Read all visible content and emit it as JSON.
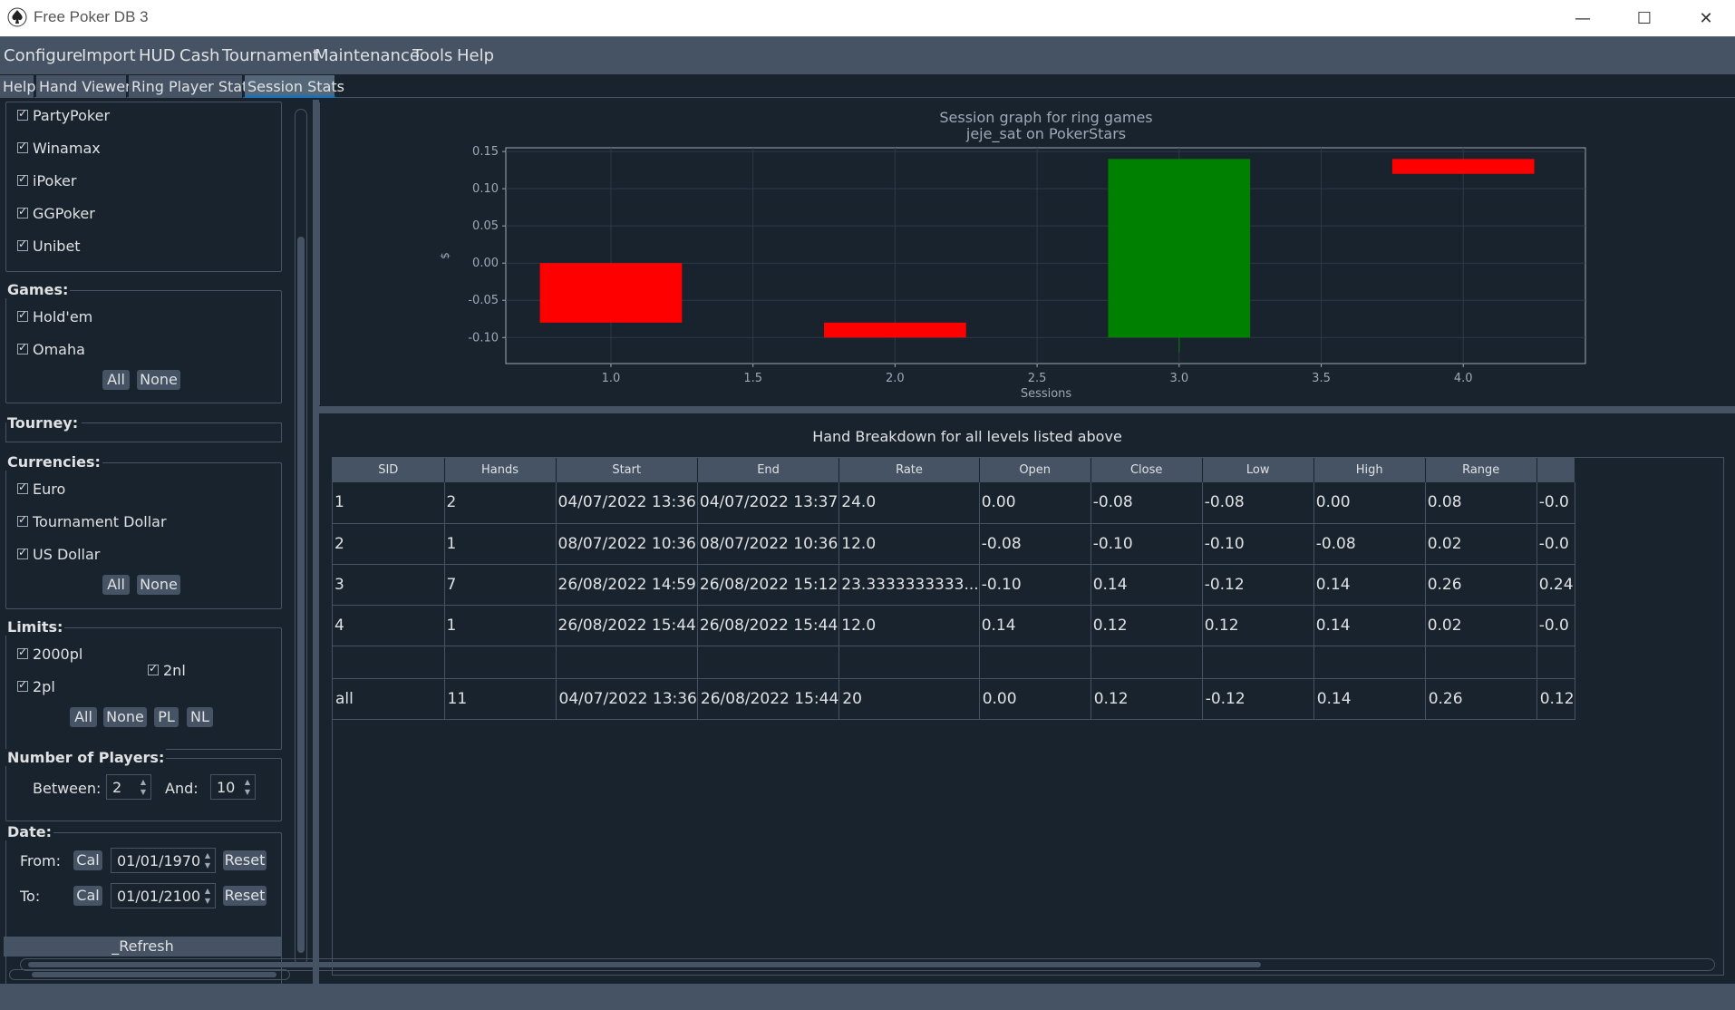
{
  "window": {
    "title": "Free Poker DB 3",
    "minimize": "—",
    "maximize": "☐",
    "close": "✕"
  },
  "menu": [
    "Configure",
    "Import",
    "HUD",
    "Cash",
    "Tournament",
    "Maintenance",
    "Tools",
    "Help"
  ],
  "tabs": [
    "Help",
    "Hand Viewer",
    "Ring Player Stats",
    "Session Stats"
  ],
  "active_tab": "Session Stats",
  "filters": {
    "sites": [
      "PartyPoker",
      "Winamax",
      "iPoker",
      "GGPoker",
      "Unibet"
    ],
    "games_label": "Games:",
    "games": [
      "Hold'em",
      "Omaha"
    ],
    "tourney_label": "Tourney:",
    "currencies_label": "Currencies:",
    "currencies": [
      "Euro",
      "Tournament Dollar",
      "US Dollar"
    ],
    "limits_label": "Limits:",
    "limits": [
      "2000pl",
      "2nl",
      "2pl"
    ],
    "all_label": "All",
    "none_label": "None",
    "pl_label": "PL",
    "nl_label": "NL",
    "players_label": "Number of Players:",
    "between_label": "Between:",
    "and_label": "And:",
    "players_min": "2",
    "players_max": "10",
    "date_label": "Date:",
    "from_label": "From:",
    "to_label": "To:",
    "cal_label": "Cal",
    "reset_label": "Reset",
    "from_date": "01/01/1970",
    "to_date": "01/01/2100",
    "refresh_label": "_Refresh"
  },
  "chart_data": {
    "type": "candlestick",
    "title": "Session graph for ring games",
    "subtitle": "jeje_sat on PokerStars",
    "xlabel": "Sessions",
    "ylabel": "$",
    "xlim": [
      0.63,
      4.43
    ],
    "ylim": [
      -0.135,
      0.155
    ],
    "xticks": [
      "1.0",
      "1.5",
      "2.0",
      "2.5",
      "3.0",
      "3.5",
      "4.0"
    ],
    "yticks": [
      "0.15",
      "0.10",
      "0.05",
      "0.00",
      "-0.05",
      "-0.10"
    ],
    "candles": [
      {
        "x": 1,
        "open": 0.0,
        "close": -0.08,
        "low": -0.08,
        "high": 0.0,
        "color": "#ff0000"
      },
      {
        "x": 2,
        "open": -0.08,
        "close": -0.1,
        "low": -0.1,
        "high": -0.08,
        "color": "#ff0000"
      },
      {
        "x": 3,
        "open": -0.1,
        "close": 0.14,
        "low": -0.12,
        "high": 0.14,
        "color": "#008000"
      },
      {
        "x": 4,
        "open": 0.14,
        "close": 0.12,
        "low": 0.12,
        "high": 0.14,
        "color": "#ff0000"
      }
    ]
  },
  "table": {
    "title": "Hand Breakdown for all levels listed above",
    "columns": [
      "SID",
      "Hands",
      "Start",
      "End",
      "Rate",
      "Open",
      "Close",
      "Low",
      "High",
      "Range",
      ""
    ],
    "rows": [
      [
        "1",
        "2",
        "04/07/2022 13:36",
        "04/07/2022 13:37",
        "24.0",
        "0.00",
        "-0.08",
        "-0.08",
        "0.00",
        "0.08",
        "-0.0"
      ],
      [
        "2",
        "1",
        "08/07/2022 10:36",
        "08/07/2022 10:36",
        "12.0",
        "-0.08",
        "-0.10",
        "-0.10",
        "-0.08",
        "0.02",
        "-0.0"
      ],
      [
        "3",
        "7",
        "26/08/2022 14:59",
        "26/08/2022 15:12",
        "23.3333333333...",
        "-0.10",
        "0.14",
        "-0.12",
        "0.14",
        "0.26",
        "0.24"
      ],
      [
        "4",
        "1",
        "26/08/2022 15:44",
        "26/08/2022 15:44",
        "12.0",
        "0.14",
        "0.12",
        "0.12",
        "0.14",
        "0.02",
        "-0.0"
      ],
      [
        "",
        "",
        "",
        "",
        "",
        "",
        "",
        "",
        "",
        "",
        ""
      ],
      [
        "all",
        "11",
        "04/07/2022 13:36",
        "26/08/2022 15:44",
        "20",
        "0.00",
        "0.12",
        "-0.12",
        "0.14",
        "0.26",
        "0.12"
      ]
    ]
  },
  "colors": {
    "background": "#19232d",
    "panel": "#455364",
    "text": "#e0e1e3",
    "accent": "#1a72bb"
  }
}
